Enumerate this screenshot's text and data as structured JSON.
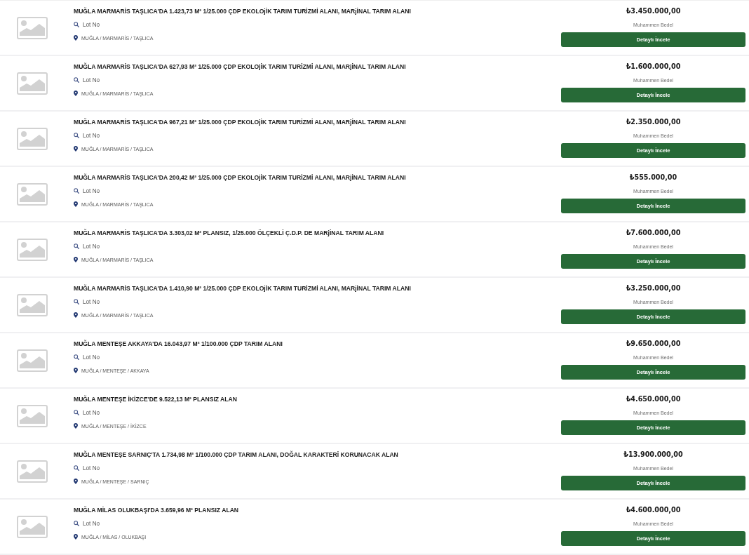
{
  "listings": [
    {
      "title": "MUĞLA MARMARİS TAŞLICA'DA 1.423,73 M² 1/25.000 ÇDP EKOLOjİK TARIM TURİZMİ ALANI, MARjİNAL TARIM ALANI",
      "lot_label": "Lot No",
      "location": "MUĞLA / MARMARİS / TAŞLICA",
      "price": "₺3.450.000,00",
      "price_label": "Muhammen Bedel",
      "button": "Detaylı İncele"
    },
    {
      "title": "MUĞLA MARMARİS TAŞLICA'DA 627,93 M² 1/25.000 ÇDP EKOLOjİK TARIM TURİZMİ ALANI, MARjİNAL TARIM ALANI",
      "lot_label": "Lot No",
      "location": "MUĞLA / MARMARİS / TAŞLICA",
      "price": "₺1.600.000,00",
      "price_label": "Muhammen Bedel",
      "button": "Detaylı İncele"
    },
    {
      "title": "MUĞLA MARMARİS TAŞLICA'DA 967,21 M² 1/25.000 ÇDP EKOLOjİK TARIM TURİZMİ ALANI, MARjİNAL TARIM ALANI",
      "lot_label": "Lot No",
      "location": "MUĞLA / MARMARİS / TAŞLICA",
      "price": "₺2.350.000,00",
      "price_label": "Muhammen Bedel",
      "button": "Detaylı İncele"
    },
    {
      "title": "MUĞLA MARMARİS TAŞLICA'DA 200,42 M² 1/25.000 ÇDP EKOLOjİK TARIM TURİZMİ ALANI, MARjİNAL TARIM ALANI",
      "lot_label": "Lot No",
      "location": "MUĞLA / MARMARİS / TAŞLICA",
      "price": "₺555.000,00",
      "price_label": "Muhammen Bedel",
      "button": "Detaylı İncele"
    },
    {
      "title": "MUĞLA MARMARİS TAŞLICA'DA 3.303,02 M² PLANSIZ, 1/25.000 ÖLÇEKLİ Ç.D.P. DE MARjİNAL TARIM ALANI",
      "lot_label": "Lot No",
      "location": "MUĞLA / MARMARİS / TAŞLICA",
      "price": "₺7.600.000,00",
      "price_label": "Muhammen Bedel",
      "button": "Detaylı İncele"
    },
    {
      "title": "MUĞLA MARMARİS TAŞLICA'DA 1.410,90 M² 1/25.000 ÇDP EKOLOjİK TARIM TURİZMİ ALANI, MARjİNAL TARIM ALANI",
      "lot_label": "Lot No",
      "location": "MUĞLA / MARMARİS / TAŞLICA",
      "price": "₺3.250.000,00",
      "price_label": "Muhammen Bedel",
      "button": "Detaylı İncele"
    },
    {
      "title": "MUĞLA MENTEŞE AKKAYA'DA 16.043,97 M² 1/100.000 ÇDP TARIM ALANI",
      "lot_label": "Lot No",
      "location": "MUĞLA / MENTEŞE / AKKAYA",
      "price": "₺9.650.000,00",
      "price_label": "Muhammen Bedel",
      "button": "Detaylı İncele"
    },
    {
      "title": "MUĞLA MENTEŞE İKİZCE'DE 9.522,13 M² PLANSIZ ALAN",
      "lot_label": "Lot No",
      "location": "MUĞLA / MENTEŞE / İKİZCE",
      "price": "₺4.650.000,00",
      "price_label": "Muhammen Bedel",
      "button": "Detaylı İncele"
    },
    {
      "title": "MUĞLA MENTEŞE SARNIÇ'TA 1.734,98 M² 1/100.000 ÇDP TARIM ALANI, DOĞAL KARAKTERİ KORUNACAK ALAN",
      "lot_label": "Lot No",
      "location": "MUĞLA / MENTEŞE / SARNIÇ",
      "price": "₺13.900.000,00",
      "price_label": "Muhammen Bedel",
      "button": "Detaylı İncele"
    },
    {
      "title": "MUĞLA MİLAS OLUKBAŞI'DA 3.659,96 M² PLANSIZ ALAN",
      "lot_label": "Lot No",
      "location": "MUĞLA / MİLAS / OLUKBAŞI",
      "price": "₺4.600.000,00",
      "price_label": "Muhammen Bedel",
      "button": "Detaylı İncele"
    }
  ]
}
